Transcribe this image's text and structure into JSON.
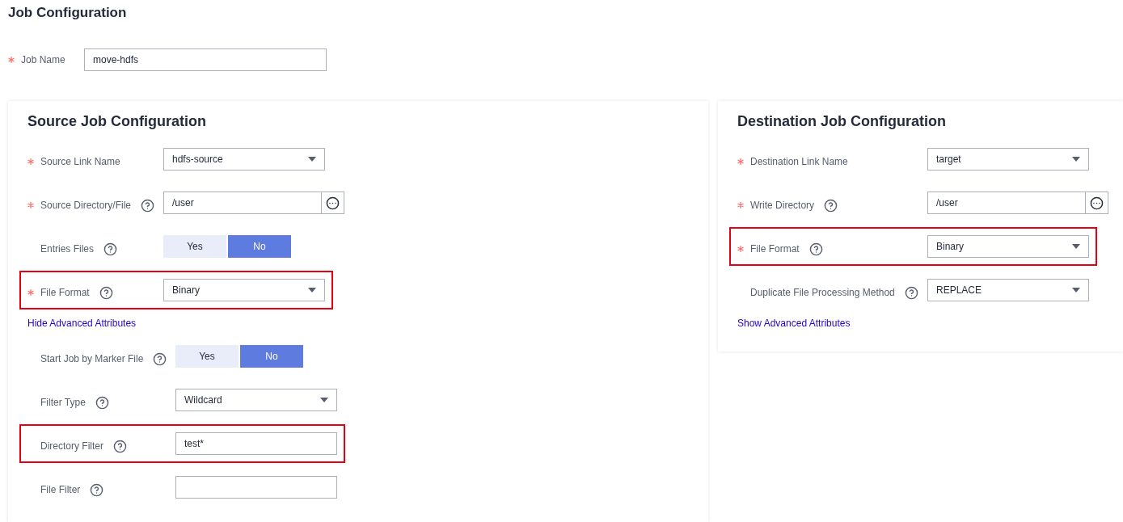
{
  "page_title": "Job Configuration",
  "job_name": {
    "label": "Job Name",
    "required": true,
    "value": "move-hdfs"
  },
  "source": {
    "title": "Source Job Configuration",
    "fields": [
      {
        "kind": "select",
        "label": "Source Link Name",
        "required": true,
        "help": false,
        "highlighted": false,
        "value": "hdfs-source"
      },
      {
        "kind": "browse",
        "label": "Source Directory/File",
        "required": true,
        "help": true,
        "highlighted": false,
        "value": "/user"
      },
      {
        "kind": "toggle",
        "label": "Entries Files",
        "required": false,
        "help": true,
        "highlighted": false,
        "options": [
          {
            "label": "Yes",
            "selected": false
          },
          {
            "label": "No",
            "selected": true
          }
        ]
      },
      {
        "kind": "select",
        "label": "File Format",
        "required": true,
        "help": true,
        "highlighted": true,
        "value": "Binary"
      }
    ],
    "advanced_link": "Hide Advanced Attributes",
    "advanced_fields": [
      {
        "kind": "toggle",
        "label": "Start Job by Marker File",
        "required": false,
        "help": true,
        "highlighted": false,
        "options": [
          {
            "label": "Yes",
            "selected": false
          },
          {
            "label": "No",
            "selected": true
          }
        ]
      },
      {
        "kind": "select",
        "label": "Filter Type",
        "required": false,
        "help": true,
        "highlighted": false,
        "value": "Wildcard"
      },
      {
        "kind": "text",
        "label": "Directory Filter",
        "required": false,
        "help": true,
        "highlighted": true,
        "value": "test*"
      },
      {
        "kind": "text",
        "label": "File Filter",
        "required": false,
        "help": true,
        "highlighted": false
      }
    ]
  },
  "destination": {
    "title": "Destination Job Configuration",
    "fields": [
      {
        "kind": "select",
        "label": "Destination Link Name",
        "required": true,
        "help": false,
        "highlighted": false,
        "value": "target"
      },
      {
        "kind": "browse",
        "label": "Write Directory",
        "required": true,
        "help": true,
        "highlighted": false,
        "value": "/user"
      },
      {
        "kind": "select",
        "label": "File Format",
        "required": true,
        "help": true,
        "highlighted": true,
        "value": "Binary"
      },
      {
        "kind": "select",
        "label": "Duplicate File Processing Method",
        "required": false,
        "help": true,
        "highlighted": false,
        "value": "REPLACE"
      }
    ],
    "advanced_link": "Show Advanced Attributes"
  }
}
